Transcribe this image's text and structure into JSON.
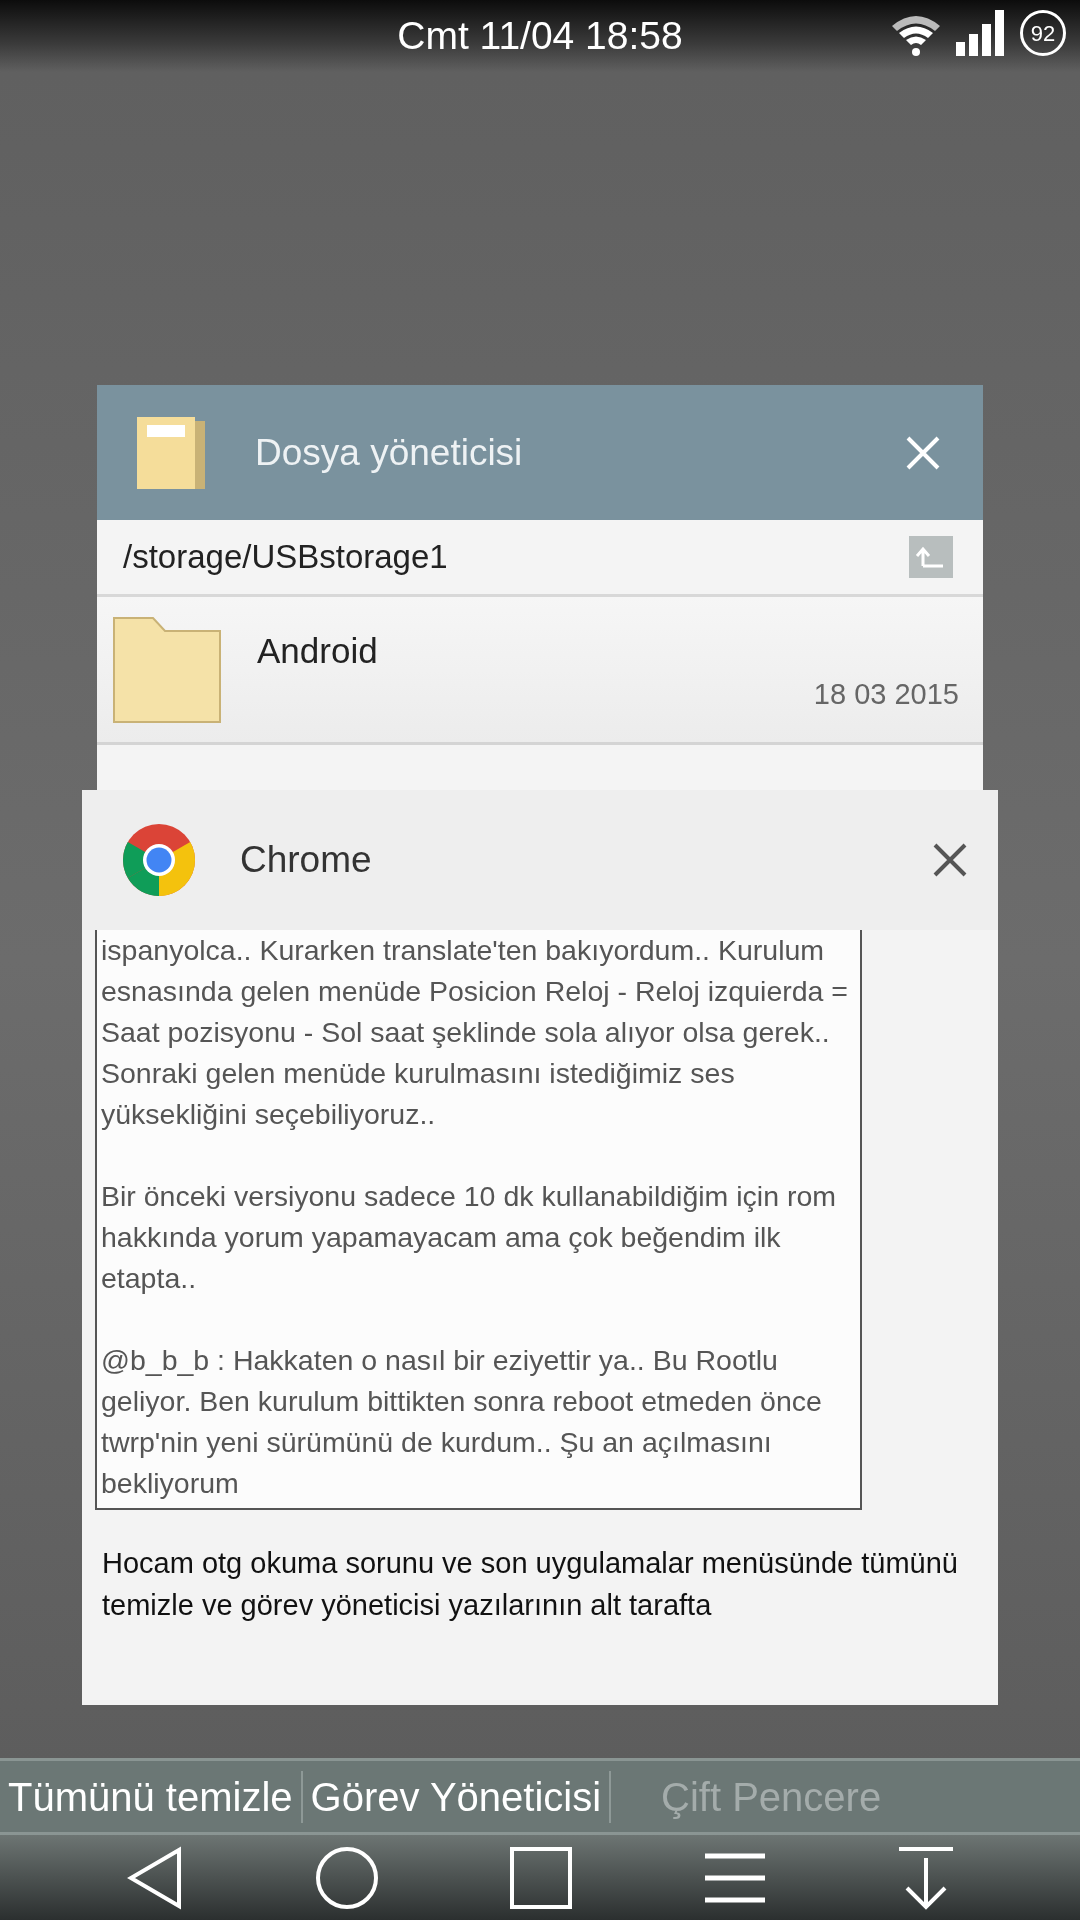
{
  "status_bar": {
    "datetime": "Cmt 11/04 18:58",
    "battery": "92"
  },
  "recent_apps": [
    {
      "kind": "files",
      "title": "Dosya yöneticisi",
      "path": "/storage/USBstorage1",
      "entries": [
        {
          "name": "Android",
          "date": "18 03 2015"
        }
      ]
    },
    {
      "kind": "browser",
      "title": "Chrome",
      "quote": [
        "ispanyolca.. Kurarken translate'ten bakıyordum.. Kurulum esnasında gelen menüde Posicion Reloj - Reloj izquierda = Saat pozisyonu - Sol saat şeklinde sola alıyor olsa gerek.. Sonraki gelen menüde kurulmasını istediğimiz ses yüksekliğini seçebiliyoruz..",
        "Bir önceki versiyonu sadece 10 dk kullanabildiğim için rom hakkında yorum yapamayacam ama çok beğendim ilk etapta..",
        "@b_b_b : Hakkaten o nasıl bir eziyettir ya.. Bu Rootlu geliyor. Ben kurulum bittikten sonra reboot etmeden önce twrp'nin yeni sürümünü de kurdum.. Şu an açılmasını bekliyorum"
      ],
      "text": "Hocam otg okuma sorunu ve son uygulamalar menüsünde tümünü temizle ve görev yöneticisi yazılarının alt tarafta"
    }
  ],
  "actions": [
    {
      "label": "Tümünü temizle",
      "disabled": false
    },
    {
      "label": "Görev Yöneticisi",
      "disabled": false
    },
    {
      "label": "Çift Pencere",
      "disabled": true
    }
  ]
}
